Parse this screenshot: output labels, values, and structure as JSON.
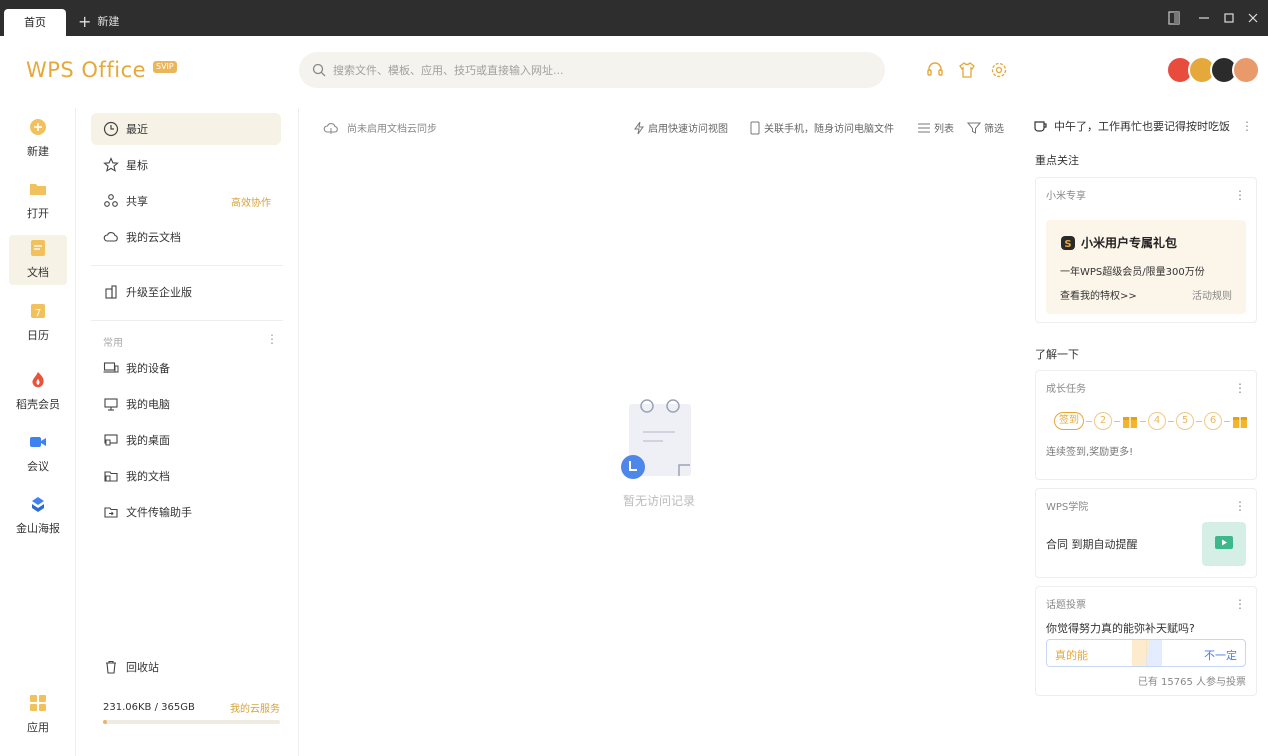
{
  "titlebar": {
    "tab_home": "首页",
    "tab_new": "新建"
  },
  "header": {
    "logo": "WPS Office",
    "badge": "SVIP",
    "search_placeholder": "搜索文件、模板、应用、技巧或直接输入网址..."
  },
  "leftnav": [
    {
      "label": "新建",
      "icon": "plus-circle-icon"
    },
    {
      "label": "打开",
      "icon": "folder-icon"
    },
    {
      "label": "文档",
      "icon": "document-icon"
    },
    {
      "label": "日历",
      "icon": "calendar-icon"
    },
    {
      "label": "稻壳会员",
      "icon": "flame-icon"
    },
    {
      "label": "会议",
      "icon": "video-icon"
    },
    {
      "label": "金山海报",
      "icon": "poster-icon"
    },
    {
      "label": "应用",
      "icon": "apps-grid-icon"
    }
  ],
  "sidebar": {
    "items": [
      {
        "label": "最近"
      },
      {
        "label": "星标"
      },
      {
        "label": "共享",
        "extra": "高效协作"
      },
      {
        "label": "我的云文档"
      },
      {
        "label": "升级至企业版"
      }
    ],
    "group_label": "常用",
    "common": [
      {
        "label": "我的设备"
      },
      {
        "label": "我的电脑"
      },
      {
        "label": "我的桌面"
      },
      {
        "label": "我的文档"
      },
      {
        "label": "文件传输助手"
      }
    ],
    "trash": "回收站",
    "storage": {
      "used": "231.06KB / 365GB",
      "link": "我的云服务",
      "percent": 0.5
    }
  },
  "main": {
    "sync_notice": "尚未启用文档云同步",
    "quick_view": "启用快速访问视图",
    "link_phone": "关联手机，随身访问电脑文件",
    "list": "列表",
    "filter": "筛选",
    "empty_text": "暂无访问记录"
  },
  "right": {
    "greeting": "中午了，工作再忙也要记得按时吃饭",
    "section_focus": "重点关注",
    "xiaomi": {
      "title": "小米专享",
      "promo_title": "小米用户专属礼包",
      "promo_desc": "一年WPS超级会员/限量300万份",
      "promo_link": "查看我的特权>>",
      "promo_rule": "活动规则"
    },
    "section_learn": "了解一下",
    "growth": {
      "title": "成长任务",
      "steps": [
        "签到",
        "2",
        "4",
        "5",
        "6"
      ],
      "note": "连续签到,奖励更多!"
    },
    "academy": {
      "title": "WPS学院",
      "text": "合同 到期自动提醒"
    },
    "vote": {
      "title": "话题投票",
      "question": "你觉得努力真的能弥补天赋吗?",
      "yes": "真的能",
      "no": "不一定",
      "count": "已有 15765 人参与投票"
    }
  }
}
